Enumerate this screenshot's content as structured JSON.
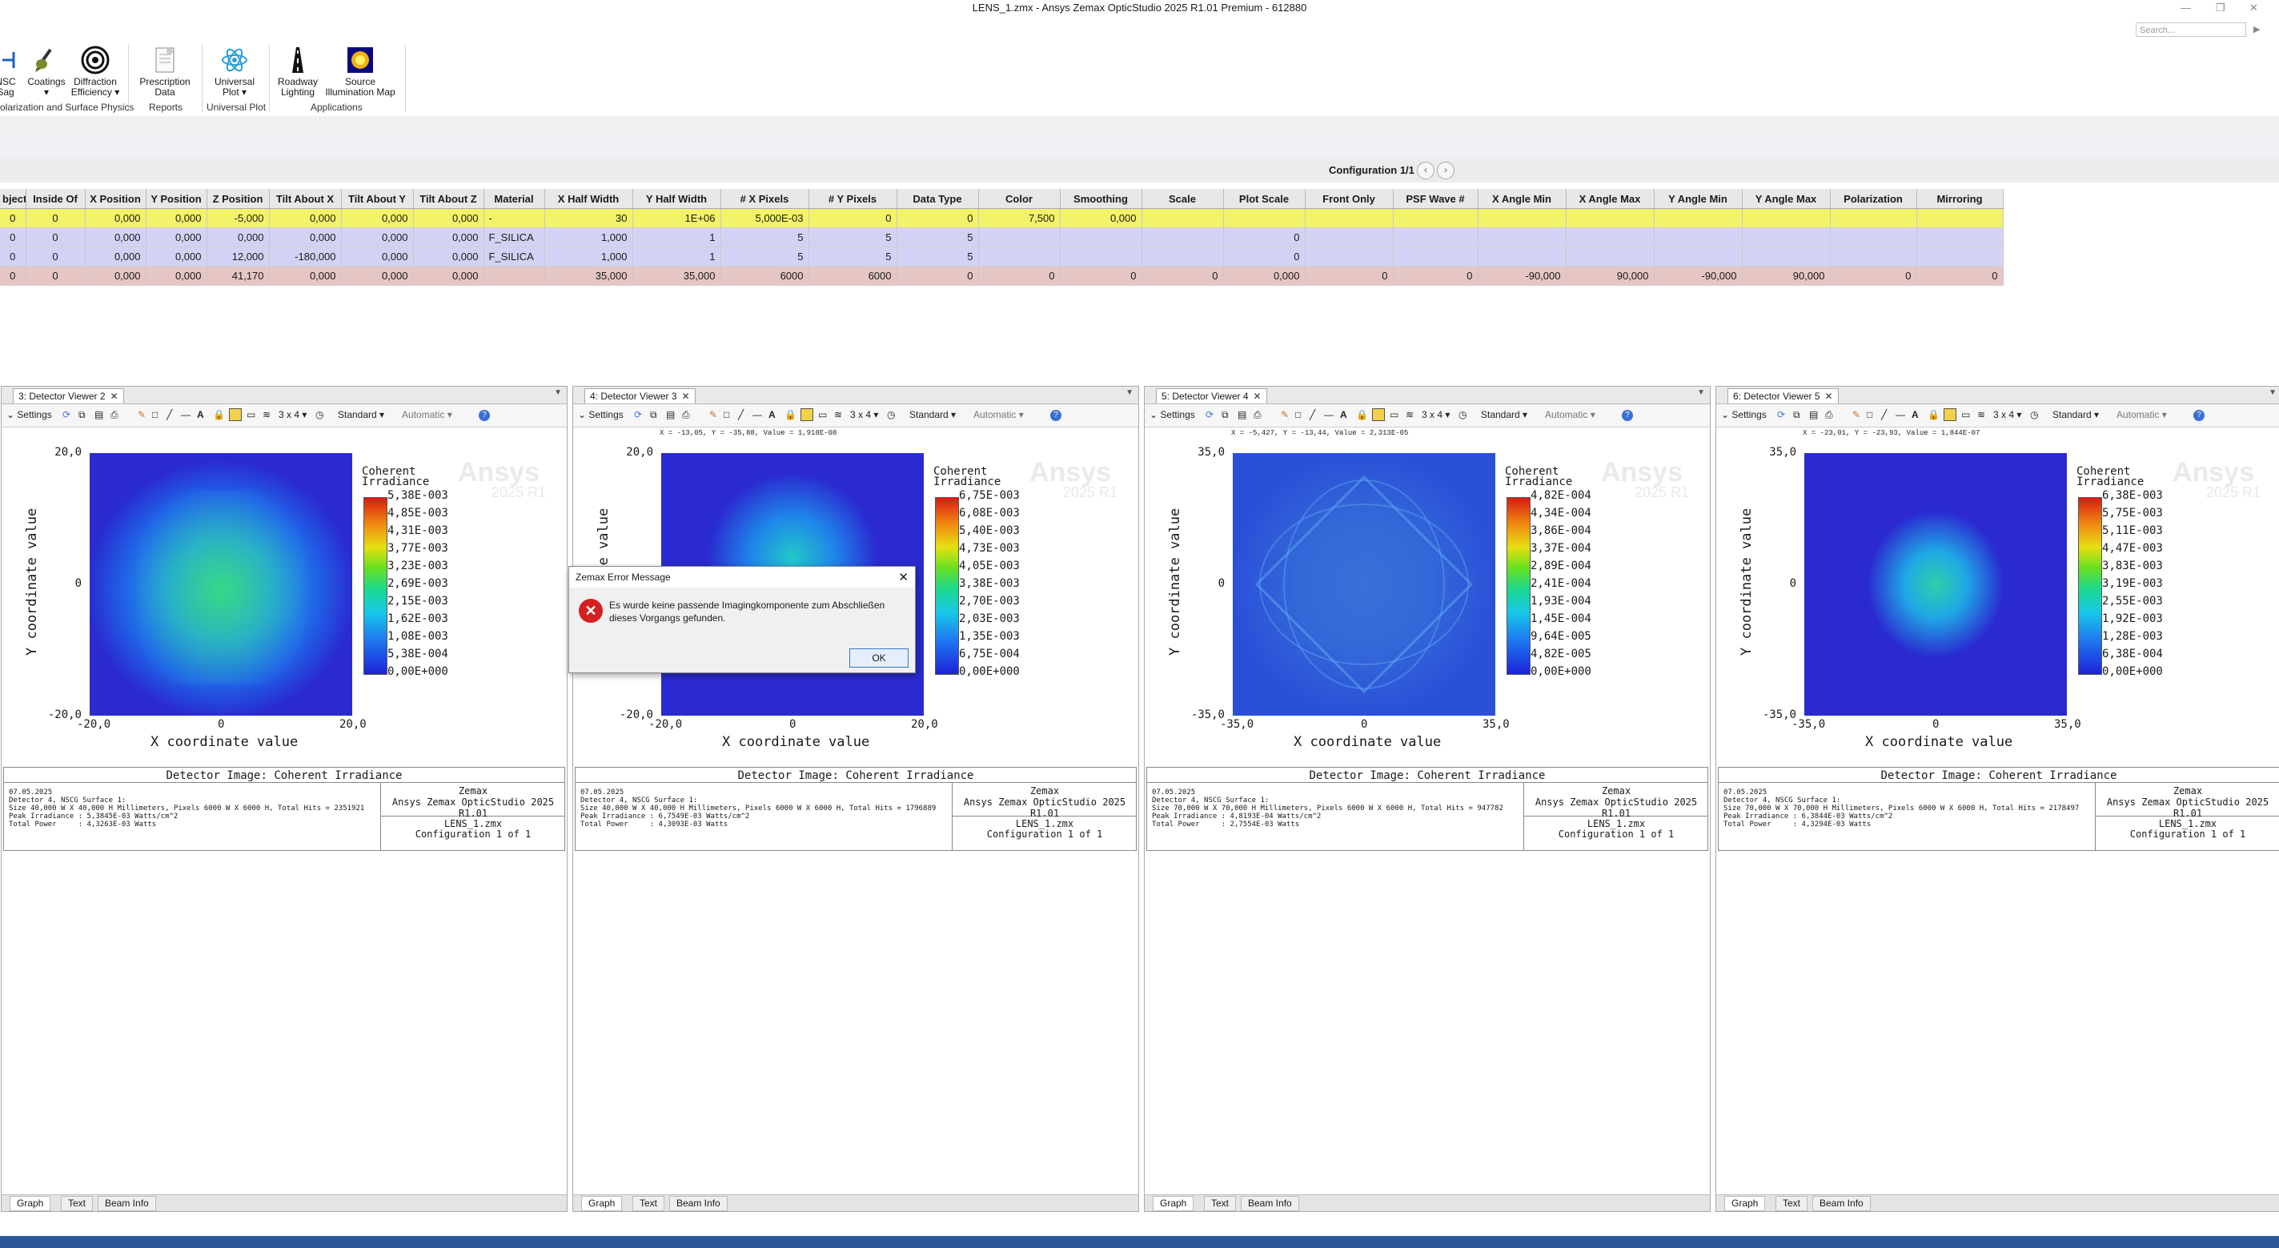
{
  "window": {
    "title": "LENS_1.zmx - Ansys Zemax OpticStudio 2025 R1.01   Premium - 612880",
    "search_placeholder": "Search..."
  },
  "ribbon": {
    "items": [
      {
        "label": "NSC",
        "label2": "Sag"
      },
      {
        "label": "Coatings",
        "label2": "▾"
      },
      {
        "label": "Diffraction",
        "label2": "Efficiency ▾"
      },
      {
        "label": "Prescription",
        "label2": "Data"
      },
      {
        "label": "Universal",
        "label2": "Plot ▾"
      },
      {
        "label": "Roadway",
        "label2": "Lighting"
      },
      {
        "label": "Source",
        "label2": "Illumination Map"
      }
    ],
    "groups": [
      "olarization and Surface Physics",
      "Reports",
      "Universal Plot",
      "Applications"
    ]
  },
  "config_bar": {
    "label": "Configuration 1/1",
    "prev": "‹",
    "next": "›"
  },
  "lens_data": {
    "columns": [
      "bject",
      "Inside Of",
      "X Position",
      "Y Position",
      "Z Position",
      "Tilt About X",
      "Tilt About Y",
      "Tilt About Z",
      "Material",
      "X Half Width",
      "Y Half Width",
      "# X Pixels",
      "# Y Pixels",
      "Data Type",
      "Color",
      "Smoothing",
      "Scale",
      "Plot Scale",
      "Front Only",
      "PSF Wave #",
      "X Angle Min",
      "X Angle Max",
      "Y Angle Min",
      "Y Angle Max",
      "Polarization",
      "Mirroring"
    ],
    "rows": [
      [
        "0",
        "0",
        "0,000",
        "0,000",
        "-5,000",
        "0,000",
        "0,000",
        "0,000",
        "-",
        "30",
        "1E+06",
        "5,000E-03",
        "0",
        "0",
        "7,500",
        "0,000",
        "",
        "",
        "",
        "",
        "",
        "",
        "",
        "",
        "",
        ""
      ],
      [
        "0",
        "0",
        "0,000",
        "0,000",
        "0,000",
        "0,000",
        "0,000",
        "0,000",
        "F_SILICA",
        "1,000",
        "1",
        "5",
        "5",
        "5",
        "",
        "",
        "",
        "0",
        "",
        "",
        "",
        "",
        "",
        "",
        "",
        ""
      ],
      [
        "0",
        "0",
        "0,000",
        "0,000",
        "12,000",
        "-180,000",
        "0,000",
        "0,000",
        "F_SILICA",
        "1,000",
        "1",
        "5",
        "5",
        "5",
        "",
        "",
        "",
        "0",
        "",
        "",
        "",
        "",
        "",
        "",
        "",
        ""
      ],
      [
        "0",
        "0",
        "0,000",
        "0,000",
        "41,170",
        "0,000",
        "0,000",
        "0,000",
        "",
        "35,000",
        "35,000",
        "6000",
        "6000",
        "0",
        "0",
        "0",
        "0",
        "0,000",
        "0",
        "0",
        "-90,000",
        "90,000",
        "-90,000",
        "90,000",
        "0",
        "0"
      ]
    ]
  },
  "viewers": [
    {
      "tab": "3: Detector Viewer 2",
      "coord_readout": "",
      "settings": "Settings",
      "layout": "3 x 4 ▾",
      "mode": "Standard ▾",
      "scale": "Automatic ▾",
      "yticks": [
        "20,0",
        "0",
        "-20,0"
      ],
      "xticks": [
        "-20,0",
        "0",
        "20,0"
      ],
      "xlabel": "X coordinate value",
      "ylabel": "Y coordinate value",
      "cbar_title": [
        "Coherent",
        "Irradiance"
      ],
      "cbar": [
        "5,38E-003",
        "4,85E-003",
        "4,31E-003",
        "3,77E-003",
        "3,23E-003",
        "2,69E-003",
        "2,15E-003",
        "1,62E-003",
        "1,08E-003",
        "5,38E-004",
        "0,00E+000"
      ],
      "watermark": "Ansys",
      "watermark2": "2025 R1",
      "info_title": "Detector Image: Coherent Irradiance",
      "info_lines": "07.05.2025\nDetector 4, NSCG Surface 1:\nSize 40,000 W X 40,000 H Millimeters, Pixels 6000 W X 6000 H, Total Hits = 2351921\nPeak Irradiance : 5,3845E-03 Watts/cm^2\nTotal Power     : 4,3263E-03 Watts",
      "info_r1": "Zemax",
      "info_r2": "Ansys Zemax OpticStudio 2025 R1.01",
      "info_r3": "LENS_1.zmx",
      "info_r4": "Configuration 1 of 1",
      "tabs": [
        "Graph",
        "Text",
        "Beam Info"
      ]
    },
    {
      "tab": "4: Detector Viewer 3",
      "coord_readout": "X = -13,05, Y = -35,88, Value = 1,918E-08",
      "settings": "Settings",
      "layout": "3 x 4 ▾",
      "mode": "Standard ▾",
      "scale": "Automatic ▾",
      "yticks": [
        "20,0",
        "0",
        "-20,0"
      ],
      "xticks": [
        "-20,0",
        "0",
        "20,0"
      ],
      "xlabel": "X coordinate value",
      "ylabel": "Y coordinate value",
      "cbar_title": [
        "Coherent",
        "Irradiance"
      ],
      "cbar": [
        "6,75E-003",
        "6,08E-003",
        "5,40E-003",
        "4,73E-003",
        "4,05E-003",
        "3,38E-003",
        "2,70E-003",
        "2,03E-003",
        "1,35E-003",
        "6,75E-004",
        "0,00E+000"
      ],
      "watermark": "Ansys",
      "watermark2": "2025 R1",
      "info_title": "Detector Image: Coherent Irradiance",
      "info_lines": "07.05.2025\nDetector 4, NSCG Surface 1:\nSize 40,000 W X 40,000 H Millimeters, Pixels 6000 W X 6000 H, Total Hits = 1796889\nPeak Irradiance : 6,7549E-03 Watts/cm^2\nTotal Power     : 4,3093E-03 Watts",
      "info_r1": "Zemax",
      "info_r2": "Ansys Zemax OpticStudio 2025 R1.01",
      "info_r3": "LENS_1.zmx",
      "info_r4": "Configuration 1 of 1",
      "tabs": [
        "Graph",
        "Text",
        "Beam Info"
      ]
    },
    {
      "tab": "5: Detector Viewer 4",
      "coord_readout": "X = -5,427, Y = -13,44, Value = 2,313E-05",
      "settings": "Settings",
      "layout": "3 x 4 ▾",
      "mode": "Standard ▾",
      "scale": "Automatic ▾",
      "yticks": [
        "35,0",
        "0",
        "-35,0"
      ],
      "xticks": [
        "-35,0",
        "0",
        "35,0"
      ],
      "xlabel": "X coordinate value",
      "ylabel": "Y coordinate value",
      "cbar_title": [
        "Coherent",
        "Irradiance"
      ],
      "cbar": [
        "4,82E-004",
        "4,34E-004",
        "3,86E-004",
        "3,37E-004",
        "2,89E-004",
        "2,41E-004",
        "1,93E-004",
        "1,45E-004",
        "9,64E-005",
        "4,82E-005",
        "0,00E+000"
      ],
      "watermark": "Ansys",
      "watermark2": "2025 R1",
      "info_title": "Detector Image: Coherent Irradiance",
      "info_lines": "07.05.2025\nDetector 4, NSCG Surface 1:\nSize 70,000 W X 70,000 H Millimeters, Pixels 6000 W X 6000 H, Total Hits = 947782\nPeak Irradiance : 4,8193E-04 Watts/cm^2\nTotal Power     : 2,7554E-03 Watts",
      "info_r1": "Zemax",
      "info_r2": "Ansys Zemax OpticStudio 2025 R1.01",
      "info_r3": "LENS_1.zmx",
      "info_r4": "Configuration 1 of 1",
      "tabs": [
        "Graph",
        "Text",
        "Beam Info"
      ]
    },
    {
      "tab": "6: Detector Viewer 5",
      "coord_readout": "X = -23,01, Y = -23,93, Value = 1,844E-07",
      "settings": "Settings",
      "layout": "3 x 4 ▾",
      "mode": "Standard ▾",
      "scale": "Automatic ▾",
      "yticks": [
        "35,0",
        "0",
        "-35,0"
      ],
      "xticks": [
        "-35,0",
        "0",
        "35,0"
      ],
      "xlabel": "X coordinate value",
      "ylabel": "Y coordinate value",
      "cbar_title": [
        "Coherent",
        "Irradiance"
      ],
      "cbar": [
        "6,38E-003",
        "5,75E-003",
        "5,11E-003",
        "4,47E-003",
        "3,83E-003",
        "3,19E-003",
        "2,55E-003",
        "1,92E-003",
        "1,28E-003",
        "6,38E-004",
        "0,00E+000"
      ],
      "watermark": "Ansys",
      "watermark2": "2025 R1",
      "info_title": "Detector Image: Coherent Irradiance",
      "info_lines": "07.05.2025\nDetector 4, NSCG Surface 1:\nSize 70,000 W X 70,000 H Millimeters, Pixels 6000 W X 6000 H, Total Hits = 2178497\nPeak Irradiance : 6,3844E-03 Watts/cm^2\nTotal Power     : 4,3294E-03 Watts",
      "info_r1": "Zemax",
      "info_r2": "Ansys Zemax OpticStudio 2025 R1.01",
      "info_r3": "LENS_1.zmx",
      "info_r4": "Configuration 1 of 1",
      "tabs": [
        "Graph",
        "Text",
        "Beam Info"
      ]
    }
  ],
  "dialog": {
    "title": "Zemax Error Message",
    "message": "Es wurde keine passende Imagingkomponente zum Abschließen dieses Vorgangs gefunden.",
    "ok": "OK",
    "icon": "error-x-icon"
  },
  "colors": {
    "accent": "#2b579a",
    "row_source": "#f2f26b",
    "row_lens": "#d4d2f4",
    "row_detector": "#e6c5c5"
  }
}
